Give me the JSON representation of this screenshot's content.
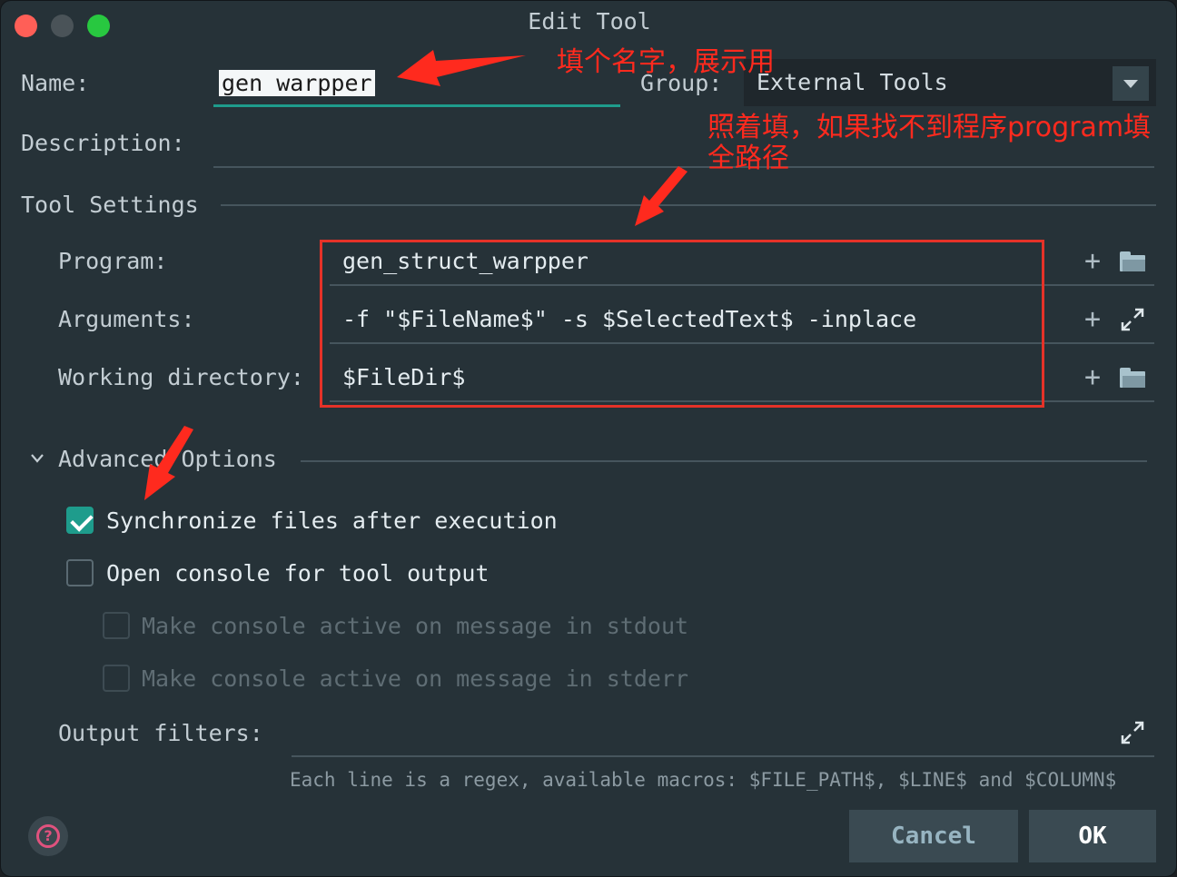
{
  "window": {
    "title": "Edit Tool",
    "traffic_lights": [
      "close",
      "minimize",
      "maximize"
    ],
    "colors": {
      "close": "#ff5f57",
      "minimize": "#4a5358",
      "maximize": "#28c840"
    }
  },
  "form": {
    "name_label": "Name:",
    "name_value": "gen warpper",
    "group_label": "Group:",
    "group_value": "External Tools",
    "description_label": "Description:",
    "description_value": ""
  },
  "tool_settings": {
    "section_label": "Tool Settings",
    "program_label": "Program:",
    "program_value": "gen_struct_warpper",
    "arguments_label": "Arguments:",
    "arguments_value": "-f \"$FileName$\" -s $SelectedText$ -inplace",
    "working_dir_label": "Working directory:",
    "working_dir_value": "$FileDir$"
  },
  "advanced": {
    "section_label": "Advanced Options",
    "sync_files_label": "Synchronize files after execution",
    "sync_files_checked": true,
    "open_console_label": "Open console for tool output",
    "open_console_checked": false,
    "stdout_label": "Make console active on message in stdout",
    "stdout_checked": false,
    "stderr_label": "Make console active on message in stderr",
    "stderr_checked": false,
    "output_filters_label": "Output filters:",
    "output_filters_value": "",
    "hint": "Each line is a regex, available macros: $FILE_PATH$, $LINE$ and $COLUMN$"
  },
  "buttons": {
    "cancel": "Cancel",
    "ok": "OK",
    "help_icon": "?"
  },
  "annotations": {
    "name_note": "填个名字，展示用",
    "program_note_line1": "照着填，如果找不到程序program填",
    "program_note_line2": "全路径",
    "color": "#ff2a1e"
  }
}
